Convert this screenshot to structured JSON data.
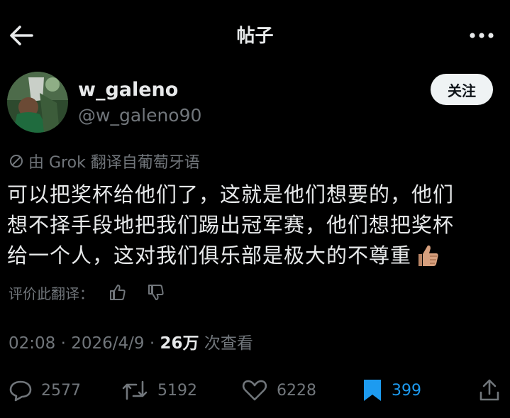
{
  "header": {
    "title": "帖子",
    "back_icon": "arrow-left-icon",
    "more_icon": "more-icon"
  },
  "author": {
    "name": "w_galeno",
    "handle": "@w_galeno90",
    "follow_label": "关注"
  },
  "post": {
    "translated_note": "由 Grok 翻译自葡萄牙语",
    "lines": [
      "可以把奖杯给他们了，这就是他们想要的，他们",
      "想不择手段地把我们踢出冠军赛，他们想把奖杯",
      "给一个人，这对我们俱乐部是极大的不尊重"
    ],
    "emoji": "thumbs-up-icon",
    "rate_label": "评价此翻译：",
    "time": "02:08",
    "date": "2026/4/9",
    "views": "26万",
    "views_suffix": "次查看"
  },
  "actions": {
    "replies": "2577",
    "reposts": "5192",
    "likes": "6228",
    "bookmarks": "399",
    "accent": "#1d9bf0"
  }
}
